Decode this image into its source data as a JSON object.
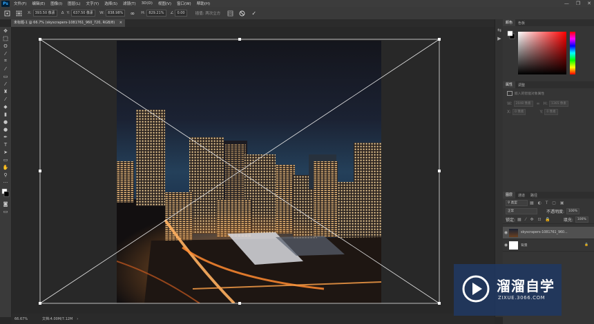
{
  "app": {
    "logo": "Ps"
  },
  "menu": [
    "文件(F)",
    "编辑(E)",
    "图像(I)",
    "图层(L)",
    "文字(Y)",
    "选择(S)",
    "滤镜(T)",
    "3D(D)",
    "视图(V)",
    "窗口(W)",
    "帮助(H)"
  ],
  "window_controls": {
    "minimize": "—",
    "restore": "❐",
    "close": "✕"
  },
  "options": {
    "x_label": "X:",
    "x_value": "393.50 像素",
    "y_label": "Y:",
    "y_value": "637.50 像素",
    "w_label": "W:",
    "w_value": "838.98%",
    "h_label": "H:",
    "h_value": "829.21%",
    "angle_value": "0.00",
    "interp_label": "插值: 两次立方"
  },
  "document": {
    "tab_title": "未标题-1 @ 66.7% (skyscrapers-1081761_960_720, RGB/8)"
  },
  "status": {
    "zoom": "66.67%",
    "doc_info": "文档:4.00M/7.12M"
  },
  "panels": {
    "color": {
      "tabs": [
        "颜色",
        "色板"
      ]
    },
    "properties": {
      "tabs": [
        "属性",
        "调整"
      ],
      "subtitle": "嵌入的智能对象属性",
      "w_label": "W:",
      "w_value": "2048 像素",
      "h_label": "H:",
      "h_value": "1365 像素",
      "x_label": "X:",
      "x_value": "0 像素",
      "y_label": "Y:",
      "y_value": "0 像素"
    },
    "layers": {
      "tabs": [
        "图层",
        "通道",
        "路径"
      ],
      "filter_label": "类型",
      "blend_mode": "正常",
      "opacity_label": "不透明度:",
      "opacity_value": "100%",
      "lock_label": "锁定:",
      "fill_label": "填充:",
      "fill_value": "100%",
      "items": [
        {
          "name": "skyscrapers-1081761_960...",
          "selected": true
        },
        {
          "name": "背景",
          "selected": false
        }
      ]
    }
  },
  "watermark": {
    "title": "溜溜自学",
    "url": "ZIXUE.3066.COM"
  },
  "colors": {
    "accent": "#31a8ff",
    "panel_bg": "#353535",
    "canvas_bg": "#282828"
  }
}
